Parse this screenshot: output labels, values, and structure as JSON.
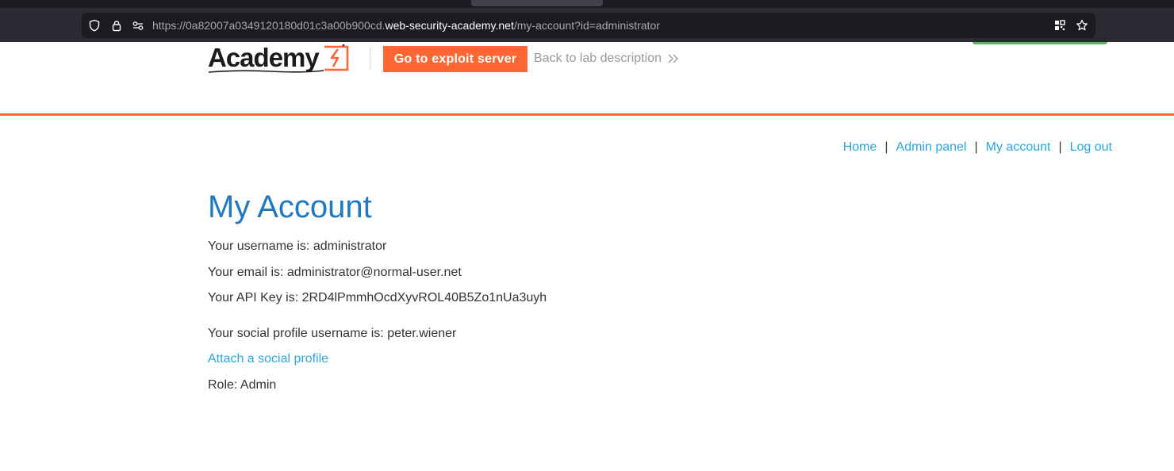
{
  "browser": {
    "url_prefix": "https://0a82007a0349120180d01c3a00b900cd.",
    "url_host": "web-security-academy.net",
    "url_path": "/my-account?id=administrator"
  },
  "header": {
    "logo_text": "Academy",
    "exploit_button": "Go to exploit server",
    "back_link": "Back to lab description"
  },
  "nav": {
    "items": [
      "Home",
      "Admin panel",
      "My account",
      "Log out"
    ],
    "separator": "|"
  },
  "account": {
    "title": "My Account",
    "username_line": "Your username is: administrator",
    "email_line": "Your email is: administrator@normal-user.net",
    "api_key_line": "Your API Key is: 2RD4lPmmhOcdXyvROL40B5Zo1nUa3uyh",
    "social_line": "Your social profile username is: peter.wiener",
    "attach_link": "Attach a social profile",
    "role_line": "Role: Admin"
  },
  "colors": {
    "accent_orange": "#ff6633",
    "link_blue": "#29a7e1",
    "title_blue": "#1e78c2",
    "chrome_dark": "#2b2a33"
  }
}
